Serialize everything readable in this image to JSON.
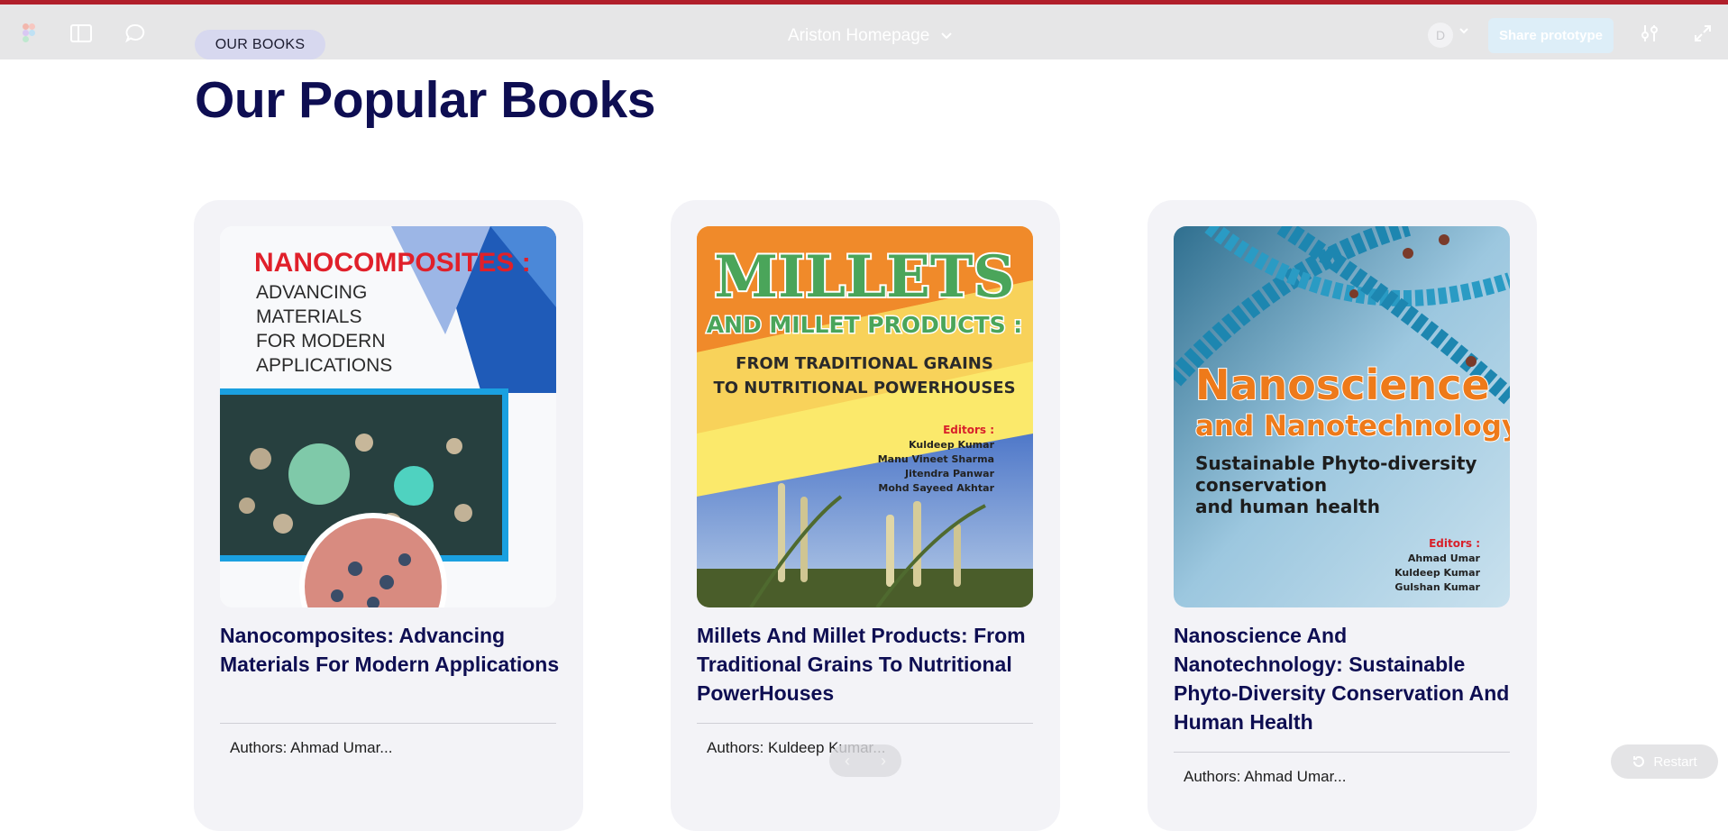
{
  "toolbar": {
    "title": "Ariston Homepage",
    "avatar_initial": "D",
    "share_label": "Share prototype"
  },
  "section": {
    "eyebrow": "OUR BOOKS",
    "title": "Our Popular Books"
  },
  "books": [
    {
      "title": "Nanocomposites: Advancing Materials For Modern Applications",
      "authors": "Authors: Ahmad Umar...",
      "cover": {
        "headline": "NANOCOMPOSITES :",
        "subtitle_lines": [
          "ADVANCING",
          "MATERIALS",
          "FOR MODERN",
          "APPLICATIONS"
        ]
      }
    },
    {
      "title": "Millets And Millet Products: From Traditional Grains To Nutritional PowerHouses",
      "authors": "Authors: Kuldeep Kumar...",
      "cover": {
        "headline": "MILLETS",
        "headline2": "AND MILLET PRODUCTS :",
        "subtitle_lines": [
          "FROM TRADITIONAL GRAINS",
          "TO NUTRITIONAL POWERHOUSES"
        ],
        "editors_label": "Editors :",
        "editors": [
          "Kuldeep Kumar",
          "Manu Vineet Sharma",
          "Jitendra Panwar",
          "Mohd Sayeed Akhtar"
        ]
      }
    },
    {
      "title": "Nanoscience And Nanotechnology: Sustainable Phyto-Diversity Conservation And Human Health",
      "authors": "Authors: Ahmad Umar...",
      "cover": {
        "headline": "Nanoscience",
        "headline2": "and Nanotechnology:",
        "subtitle_lines": [
          "Sustainable Phyto-diversity",
          "conservation",
          "and human health"
        ],
        "editors_label": "Editors :",
        "editors": [
          "Ahmad Umar",
          "Kuldeep Kumar",
          "Gulshan Kumar"
        ]
      }
    }
  ],
  "footer": {
    "restart_label": "Restart",
    "next_glyph": "›"
  },
  "colors": {
    "brand_navy": "#0e0e52",
    "accent_red": "#b11f2b",
    "card_bg": "#f3f3f7"
  }
}
